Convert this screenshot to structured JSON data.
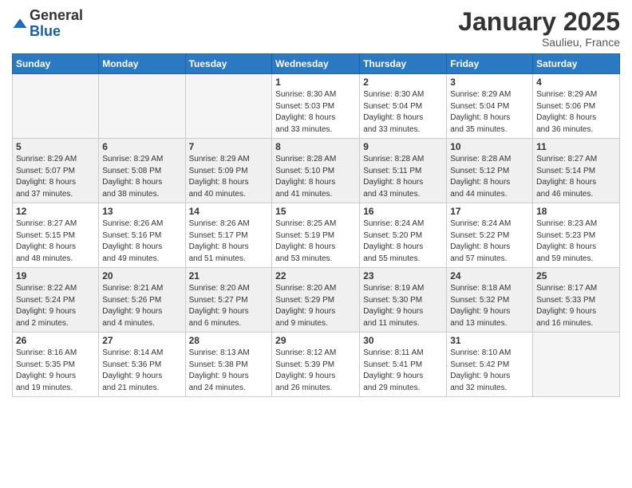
{
  "logo": {
    "general": "General",
    "blue": "Blue"
  },
  "header": {
    "month": "January 2025",
    "location": "Saulieu, France"
  },
  "weekdays": [
    "Sunday",
    "Monday",
    "Tuesday",
    "Wednesday",
    "Thursday",
    "Friday",
    "Saturday"
  ],
  "weeks": [
    [
      {
        "day": "",
        "info": ""
      },
      {
        "day": "",
        "info": ""
      },
      {
        "day": "",
        "info": ""
      },
      {
        "day": "1",
        "info": "Sunrise: 8:30 AM\nSunset: 5:03 PM\nDaylight: 8 hours\nand 33 minutes."
      },
      {
        "day": "2",
        "info": "Sunrise: 8:30 AM\nSunset: 5:04 PM\nDaylight: 8 hours\nand 33 minutes."
      },
      {
        "day": "3",
        "info": "Sunrise: 8:29 AM\nSunset: 5:04 PM\nDaylight: 8 hours\nand 35 minutes."
      },
      {
        "day": "4",
        "info": "Sunrise: 8:29 AM\nSunset: 5:06 PM\nDaylight: 8 hours\nand 36 minutes."
      }
    ],
    [
      {
        "day": "5",
        "info": "Sunrise: 8:29 AM\nSunset: 5:07 PM\nDaylight: 8 hours\nand 37 minutes."
      },
      {
        "day": "6",
        "info": "Sunrise: 8:29 AM\nSunset: 5:08 PM\nDaylight: 8 hours\nand 38 minutes."
      },
      {
        "day": "7",
        "info": "Sunrise: 8:29 AM\nSunset: 5:09 PM\nDaylight: 8 hours\nand 40 minutes."
      },
      {
        "day": "8",
        "info": "Sunrise: 8:28 AM\nSunset: 5:10 PM\nDaylight: 8 hours\nand 41 minutes."
      },
      {
        "day": "9",
        "info": "Sunrise: 8:28 AM\nSunset: 5:11 PM\nDaylight: 8 hours\nand 43 minutes."
      },
      {
        "day": "10",
        "info": "Sunrise: 8:28 AM\nSunset: 5:12 PM\nDaylight: 8 hours\nand 44 minutes."
      },
      {
        "day": "11",
        "info": "Sunrise: 8:27 AM\nSunset: 5:14 PM\nDaylight: 8 hours\nand 46 minutes."
      }
    ],
    [
      {
        "day": "12",
        "info": "Sunrise: 8:27 AM\nSunset: 5:15 PM\nDaylight: 8 hours\nand 48 minutes."
      },
      {
        "day": "13",
        "info": "Sunrise: 8:26 AM\nSunset: 5:16 PM\nDaylight: 8 hours\nand 49 minutes."
      },
      {
        "day": "14",
        "info": "Sunrise: 8:26 AM\nSunset: 5:17 PM\nDaylight: 8 hours\nand 51 minutes."
      },
      {
        "day": "15",
        "info": "Sunrise: 8:25 AM\nSunset: 5:19 PM\nDaylight: 8 hours\nand 53 minutes."
      },
      {
        "day": "16",
        "info": "Sunrise: 8:24 AM\nSunset: 5:20 PM\nDaylight: 8 hours\nand 55 minutes."
      },
      {
        "day": "17",
        "info": "Sunrise: 8:24 AM\nSunset: 5:22 PM\nDaylight: 8 hours\nand 57 minutes."
      },
      {
        "day": "18",
        "info": "Sunrise: 8:23 AM\nSunset: 5:23 PM\nDaylight: 8 hours\nand 59 minutes."
      }
    ],
    [
      {
        "day": "19",
        "info": "Sunrise: 8:22 AM\nSunset: 5:24 PM\nDaylight: 9 hours\nand 2 minutes."
      },
      {
        "day": "20",
        "info": "Sunrise: 8:21 AM\nSunset: 5:26 PM\nDaylight: 9 hours\nand 4 minutes."
      },
      {
        "day": "21",
        "info": "Sunrise: 8:20 AM\nSunset: 5:27 PM\nDaylight: 9 hours\nand 6 minutes."
      },
      {
        "day": "22",
        "info": "Sunrise: 8:20 AM\nSunset: 5:29 PM\nDaylight: 9 hours\nand 9 minutes."
      },
      {
        "day": "23",
        "info": "Sunrise: 8:19 AM\nSunset: 5:30 PM\nDaylight: 9 hours\nand 11 minutes."
      },
      {
        "day": "24",
        "info": "Sunrise: 8:18 AM\nSunset: 5:32 PM\nDaylight: 9 hours\nand 13 minutes."
      },
      {
        "day": "25",
        "info": "Sunrise: 8:17 AM\nSunset: 5:33 PM\nDaylight: 9 hours\nand 16 minutes."
      }
    ],
    [
      {
        "day": "26",
        "info": "Sunrise: 8:16 AM\nSunset: 5:35 PM\nDaylight: 9 hours\nand 19 minutes."
      },
      {
        "day": "27",
        "info": "Sunrise: 8:14 AM\nSunset: 5:36 PM\nDaylight: 9 hours\nand 21 minutes."
      },
      {
        "day": "28",
        "info": "Sunrise: 8:13 AM\nSunset: 5:38 PM\nDaylight: 9 hours\nand 24 minutes."
      },
      {
        "day": "29",
        "info": "Sunrise: 8:12 AM\nSunset: 5:39 PM\nDaylight: 9 hours\nand 26 minutes."
      },
      {
        "day": "30",
        "info": "Sunrise: 8:11 AM\nSunset: 5:41 PM\nDaylight: 9 hours\nand 29 minutes."
      },
      {
        "day": "31",
        "info": "Sunrise: 8:10 AM\nSunset: 5:42 PM\nDaylight: 9 hours\nand 32 minutes."
      },
      {
        "day": "",
        "info": ""
      }
    ]
  ]
}
